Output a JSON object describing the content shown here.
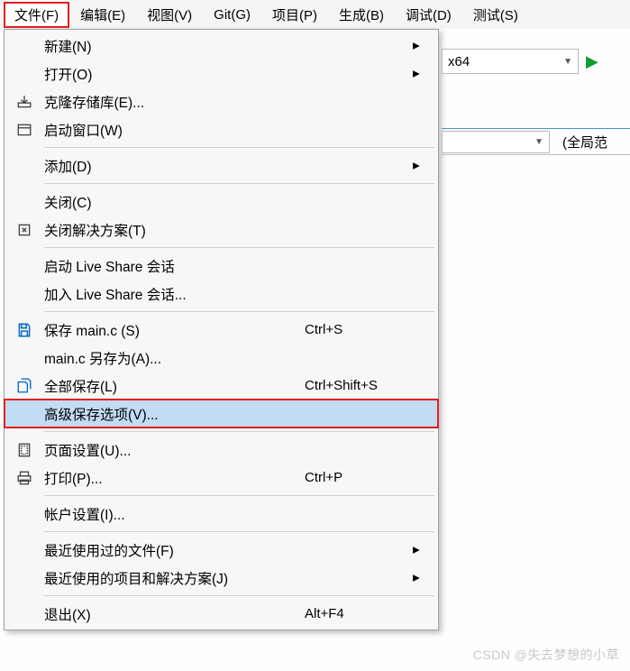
{
  "menubar": {
    "items": [
      {
        "label": "文件(F)",
        "name": "file-menu",
        "active": true
      },
      {
        "label": "编辑(E)",
        "name": "edit-menu"
      },
      {
        "label": "视图(V)",
        "name": "view-menu"
      },
      {
        "label": "Git(G)",
        "name": "git-menu"
      },
      {
        "label": "项目(P)",
        "name": "project-menu"
      },
      {
        "label": "生成(B)",
        "name": "build-menu"
      },
      {
        "label": "调试(D)",
        "name": "debug-menu"
      },
      {
        "label": "测试(S)",
        "name": "test-menu"
      }
    ]
  },
  "file_menu": {
    "groups": [
      [
        {
          "icon": "",
          "label": "新建(N)",
          "arrow": true,
          "name": "new-item"
        },
        {
          "icon": "",
          "label": "打开(O)",
          "arrow": true,
          "name": "open-item"
        },
        {
          "icon": "clone",
          "label": "克隆存储库(E)...",
          "name": "clone-repo-item"
        },
        {
          "icon": "start-window",
          "label": "启动窗口(W)",
          "name": "start-window-item"
        }
      ],
      [
        {
          "icon": "",
          "label": "添加(D)",
          "arrow": true,
          "name": "add-item"
        }
      ],
      [
        {
          "icon": "",
          "label": "关闭(C)",
          "name": "close-item"
        },
        {
          "icon": "close-solution",
          "label": "关闭解决方案(T)",
          "name": "close-solution-item"
        }
      ],
      [
        {
          "icon": "",
          "label": "启动 Live Share 会话",
          "name": "start-liveshare-item"
        },
        {
          "icon": "",
          "label": "加入 Live Share 会话...",
          "name": "join-liveshare-item"
        }
      ],
      [
        {
          "icon": "save",
          "label": "保存 main.c (S)",
          "shortcut": "Ctrl+S",
          "name": "save-item"
        },
        {
          "icon": "",
          "label": "main.c 另存为(A)...",
          "name": "save-as-item"
        },
        {
          "icon": "save-all",
          "label": "全部保存(L)",
          "shortcut": "Ctrl+Shift+S",
          "name": "save-all-item"
        },
        {
          "icon": "",
          "label": "高级保存选项(V)...",
          "highlighted": true,
          "name": "advanced-save-options-item"
        }
      ],
      [
        {
          "icon": "page-setup",
          "label": "页面设置(U)...",
          "name": "page-setup-item"
        },
        {
          "icon": "print",
          "label": "打印(P)...",
          "shortcut": "Ctrl+P",
          "name": "print-item"
        }
      ],
      [
        {
          "icon": "",
          "label": "帐户设置(I)...",
          "name": "account-settings-item"
        }
      ],
      [
        {
          "icon": "",
          "label": "最近使用过的文件(F)",
          "arrow": true,
          "name": "recent-files-item"
        },
        {
          "icon": "",
          "label": "最近使用的项目和解决方案(J)",
          "arrow": true,
          "name": "recent-projects-item"
        }
      ],
      [
        {
          "icon": "",
          "label": "退出(X)",
          "shortcut": "Alt+F4",
          "name": "exit-item"
        }
      ]
    ]
  },
  "toolbar": {
    "platform": "x64"
  },
  "scope": {
    "label": "(全局范"
  },
  "watermark": "CSDN @失去梦想的小草"
}
